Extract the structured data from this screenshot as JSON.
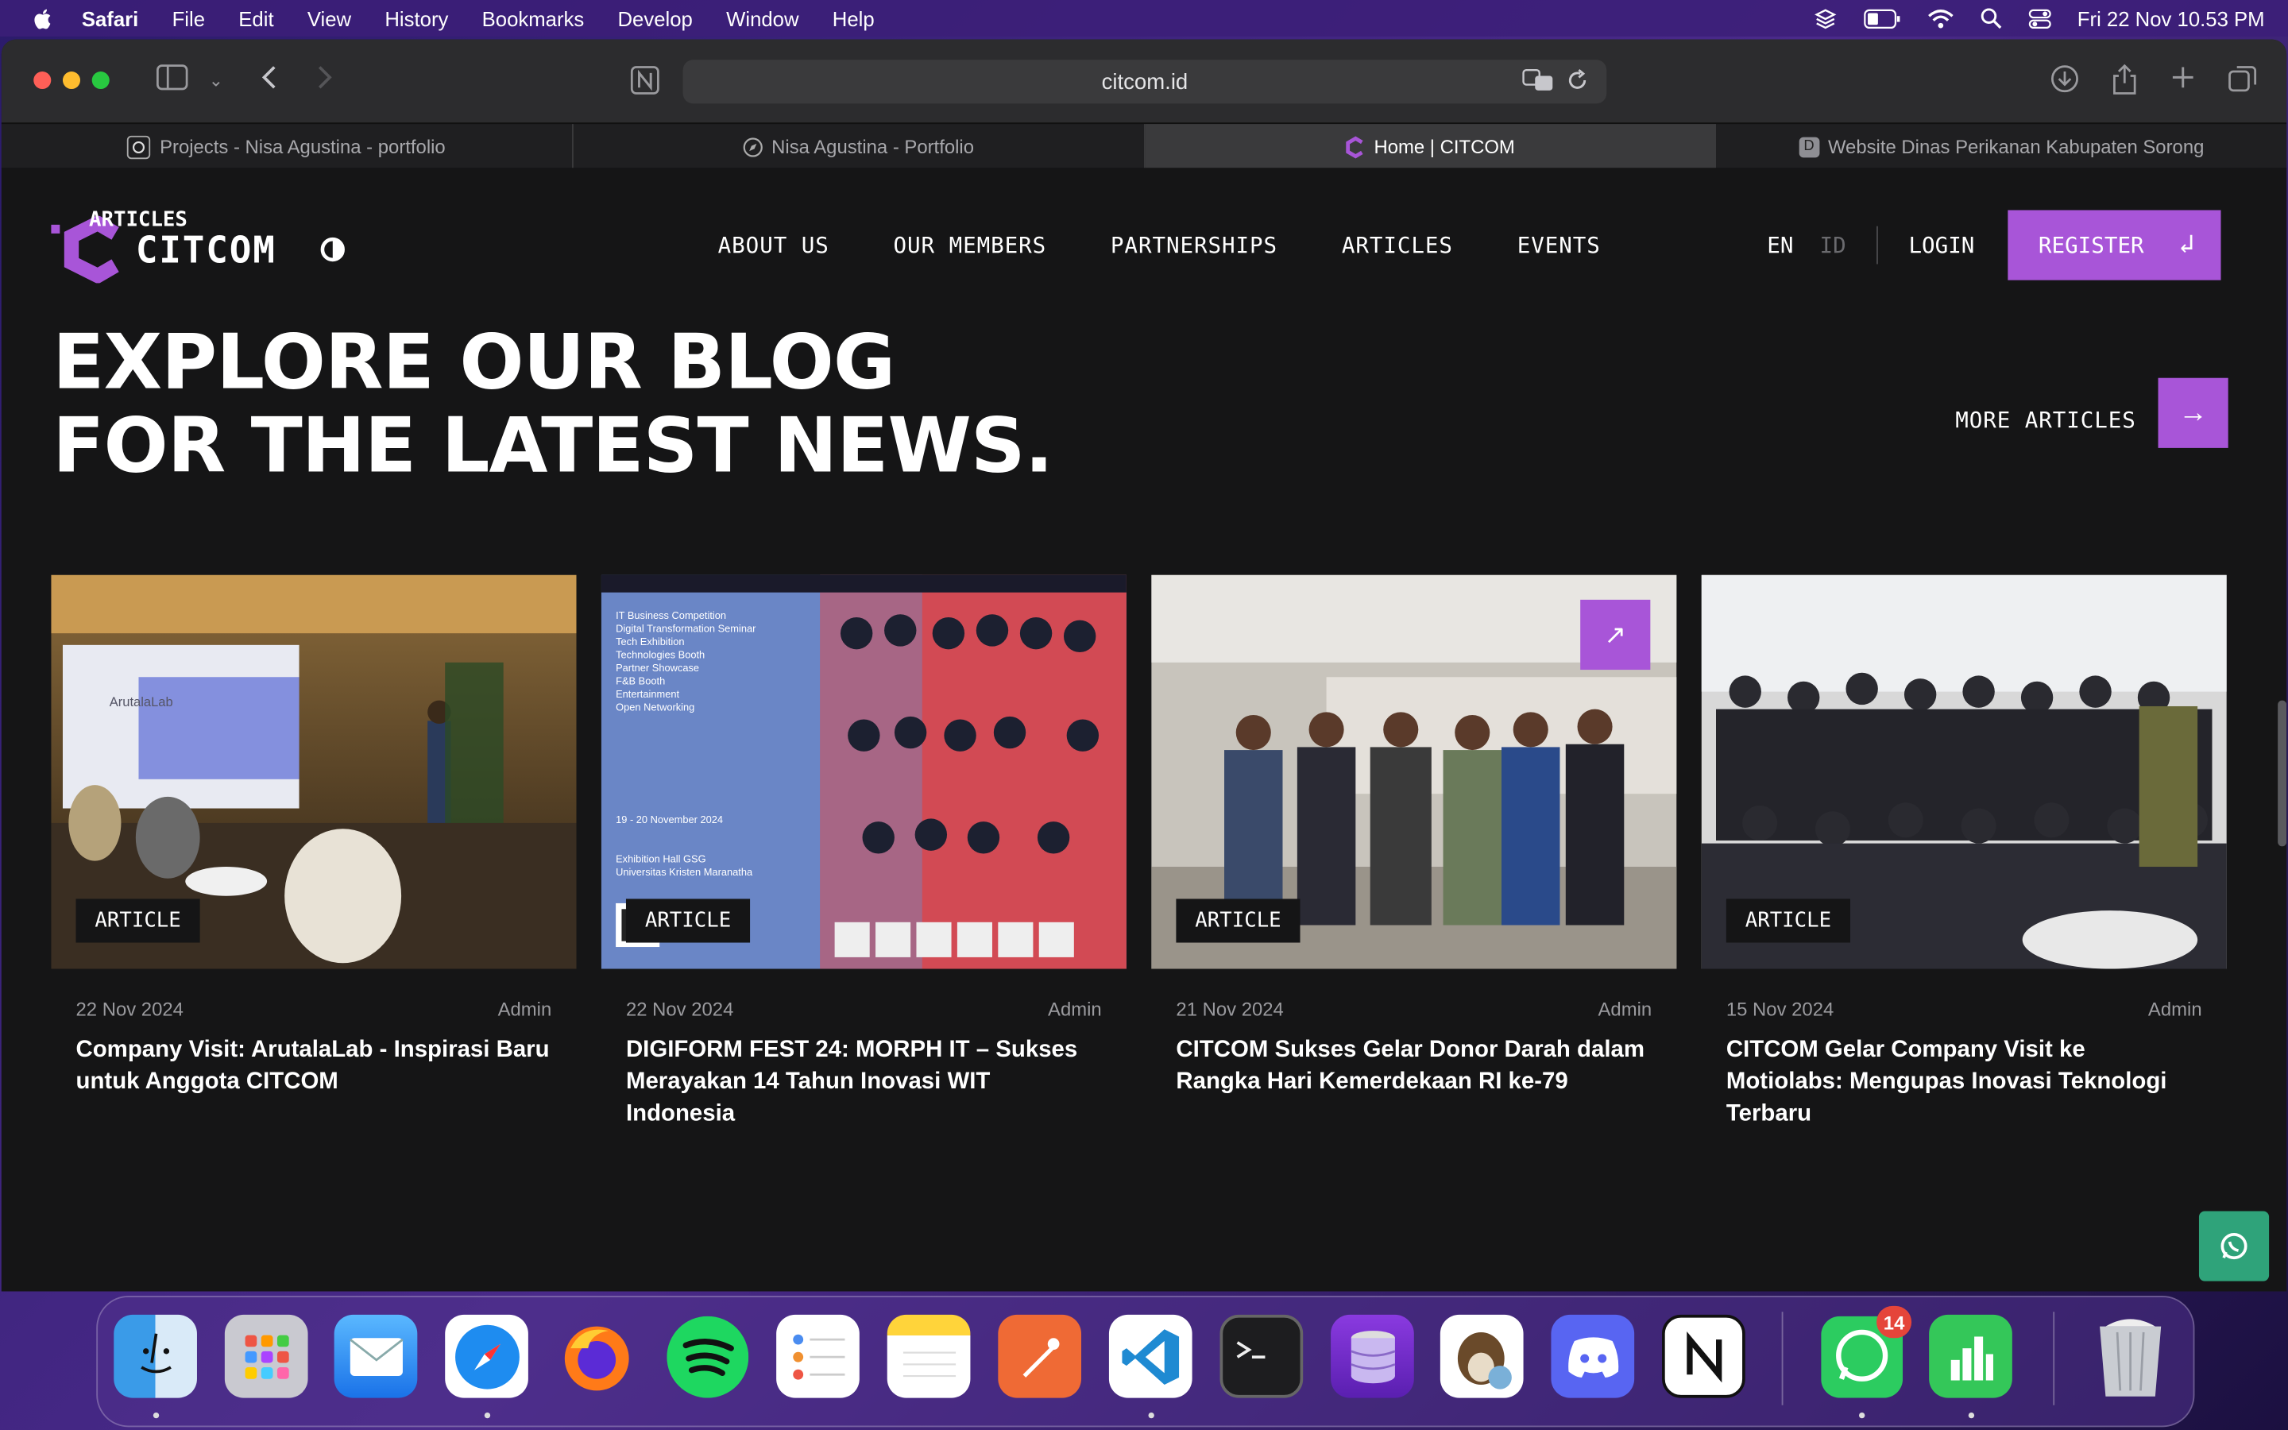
{
  "menubar": {
    "app": "Safari",
    "items": [
      "File",
      "Edit",
      "View",
      "History",
      "Bookmarks",
      "Develop",
      "Window",
      "Help"
    ],
    "clock": "Fri 22 Nov  10.53 PM"
  },
  "browser": {
    "url": "citcom.id",
    "tabs": [
      {
        "label": "Projects - Nisa Agustina - portfolio"
      },
      {
        "label": "Nisa Agustina - Portfolio"
      },
      {
        "label": "Home | CITCOM"
      },
      {
        "label": "Website Dinas Perikanan Kabupaten Sorong"
      }
    ],
    "tab_favicon_letter": "D"
  },
  "site": {
    "logo_text": "CITCOM",
    "logo_ghost_text": "ARTICLES",
    "nav": [
      "ABOUT US",
      "OUR MEMBERS",
      "PARTNERSHIPS",
      "ARTICLES",
      "EVENTS"
    ],
    "lang_en": "EN",
    "lang_id": "ID",
    "login": "LOGIN",
    "register": "REGISTER",
    "brand_color": "#a855d8"
  },
  "hero": {
    "line1": "EXPLORE OUR BLOG",
    "line2": "FOR THE LATEST NEWS.",
    "more_articles": "MORE ARTICLES"
  },
  "articles": [
    {
      "tag": "ARTICLE",
      "date": "22 Nov 2024",
      "author": "Admin",
      "title": "Company Visit: ArutalaLab - Inspirasi Baru untuk Anggota CITCOM"
    },
    {
      "tag": "ARTICLE",
      "date": "22 Nov 2024",
      "author": "Admin",
      "title": "DIGIFORM FEST 24: MORPH IT – Sukses Merayakan 14 Tahun Inovasi WIT Indonesia"
    },
    {
      "tag": "ARTICLE",
      "date": "21 Nov 2024",
      "author": "Admin",
      "title": "CITCOM Sukses Gelar Donor Darah dalam Rangka Hari Kemerdekaan RI ke-79"
    },
    {
      "tag": "ARTICLE",
      "date": "15 Nov 2024",
      "author": "Admin",
      "title": "CITCOM Gelar Company Visit ke Motiolabs: Mengupas Inovasi Teknologi Terbaru"
    }
  ],
  "card_images": {
    "poster_lines": [
      "IT Business Competition",
      "Digital Transformation Seminar",
      "Tech Exhibition",
      "Technologies Booth",
      "Partner Showcase",
      "F&B Booth",
      "Entertainment",
      "Open Networking"
    ],
    "poster_date": "19 - 20 November 2024",
    "poster_venue_1": "Exhibition Hall GSG",
    "poster_venue_2": "Universitas Kristen Maranatha",
    "screen_text": "ArutalaLab"
  },
  "dock": {
    "whatsapp_badge": "14"
  }
}
